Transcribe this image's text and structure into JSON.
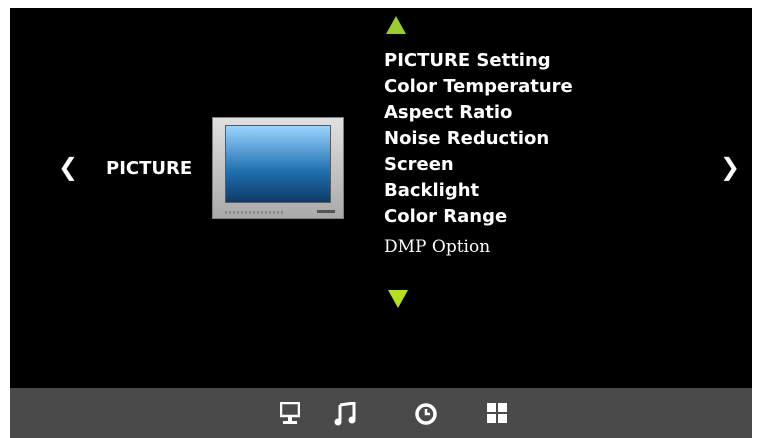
{
  "screen": {
    "category": "PICTURE",
    "menu_items": [
      "PICTURE Setting",
      "Color Temperature",
      "Aspect Ratio",
      "Noise Reduction",
      "Screen",
      "Backlight",
      "Color Range",
      "DMP Option"
    ],
    "left_arrow": "❮",
    "right_arrow": "❯"
  },
  "bottom_bar": {
    "icons": [
      "monitor-icon",
      "music-icon",
      "clock-icon",
      "grid-icon"
    ]
  },
  "colors": {
    "background": "#000000",
    "text": "#ffffff",
    "arrow_up": "#9acd32",
    "arrow_down": "#b4e01f",
    "bar": "#4a4a4a"
  }
}
